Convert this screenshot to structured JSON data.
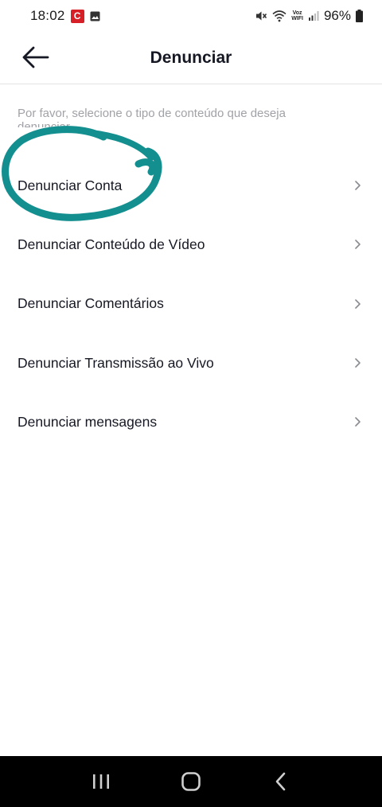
{
  "status_bar": {
    "time": "18:02",
    "notification_c": "C",
    "voz": "Voz",
    "wifi": "WIFI",
    "battery": "96%"
  },
  "header": {
    "title": "Denunciar"
  },
  "instructions": "Por favor, selecione o tipo de conteúdo que deseja denunciar",
  "menu": [
    {
      "label": "Denunciar Conta"
    },
    {
      "label": "Denunciar Conteúdo de Vídeo"
    },
    {
      "label": "Denunciar Comentários"
    },
    {
      "label": "Denunciar Transmissão ao Vivo"
    },
    {
      "label": "Denunciar mensagens"
    }
  ],
  "colors": {
    "annotation": "#148f8f",
    "text_primary": "#161823",
    "text_secondary": "#a1a2a7",
    "nav_bar": "#000000"
  },
  "icons": {
    "back": "arrow-left-icon",
    "chevron": "chevron-right-icon",
    "nav_recent": "recent-apps-icon",
    "nav_home": "home-icon",
    "nav_back": "nav-back-icon"
  }
}
